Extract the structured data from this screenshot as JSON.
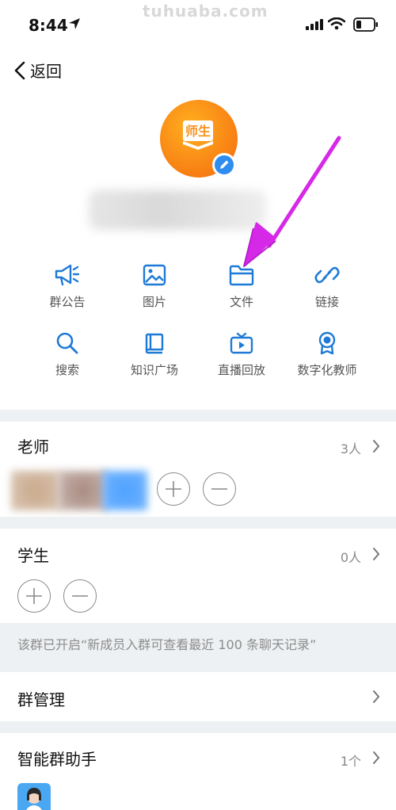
{
  "status_bar": {
    "time": "8:44",
    "watermark": "tuhuaba.com"
  },
  "nav": {
    "back_label": "返回"
  },
  "group": {
    "avatar_text": "师生"
  },
  "functions": [
    {
      "label": "群公告",
      "icon": "megaphone-icon"
    },
    {
      "label": "图片",
      "icon": "image-icon"
    },
    {
      "label": "文件",
      "icon": "folder-icon"
    },
    {
      "label": "链接",
      "icon": "link-icon"
    },
    {
      "label": "搜索",
      "icon": "search-icon"
    },
    {
      "label": "知识广场",
      "icon": "book-icon"
    },
    {
      "label": "直播回放",
      "icon": "tv-icon"
    },
    {
      "label": "数字化教师",
      "icon": "badge-icon"
    }
  ],
  "teachers": {
    "title": "老师",
    "count": "3人"
  },
  "students": {
    "title": "学生",
    "count": "0人"
  },
  "notice": {
    "text": "该群已开启“新成员入群可查看最近 100 条聊天记录”"
  },
  "group_manage": {
    "title": "群管理"
  },
  "assistant": {
    "title": "智能群助手",
    "count": "1个"
  },
  "colors": {
    "accent": "#2f8cf0",
    "avatar_orange": "#f7931e",
    "arrow": "#d629e8",
    "divider": "#eef1f3"
  }
}
